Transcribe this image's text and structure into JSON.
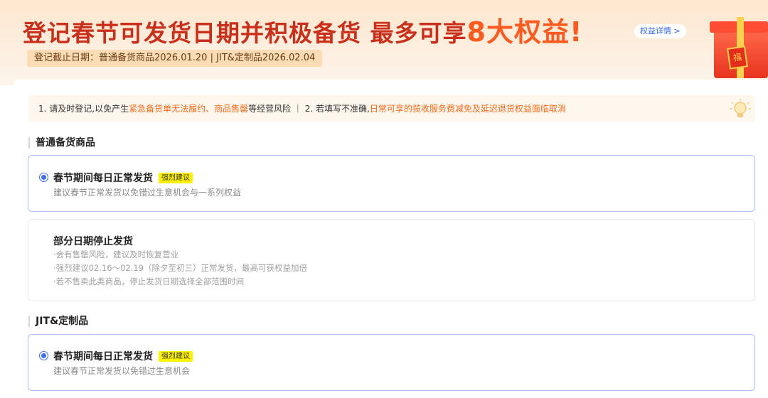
{
  "banner": {
    "title_main": "登记春节可发货日期并积极备货 最多可享",
    "title_accent": "8大权益!",
    "benefit_link": "权益详情 >",
    "deadline": "登记截止日期：普通备货商品2026.01.20 | JIT&定制品2026.02.04",
    "gift_tag": "福"
  },
  "notice": {
    "part1": "1. 请及时登记,以免产生",
    "part1_hl": "紧急备货单无法履约、商品售罄",
    "part2": "等经营风险 ｜ 2. 若填写不准确,",
    "part2_hl": "日常可享的揽收服务费减免及延迟退货权益面临取消"
  },
  "sections": {
    "regular": {
      "title": "普通备货商品",
      "option_normal": {
        "title": "春节期间每日正常发货",
        "badge": "强烈建议",
        "desc": "建议春节正常发货以免错过生意机会与一系列权益"
      },
      "option_partial": {
        "title": "部分日期停止发货",
        "bullets": [
          "·会有售罄风险，建议及时恢复营业",
          "·强烈建议02.16～02.19（除夕至初三）正常发货，最高可获权益加倍",
          "·若不售卖此类商品，停止发货日期选择全部范围时间"
        ]
      }
    },
    "jit": {
      "title": "JIT&定制品",
      "option_normal": {
        "title": "春节期间每日正常发货",
        "badge": "强烈建议",
        "desc": "建议春节正常发货以免错过生意机会"
      }
    }
  },
  "colors": {
    "banner_title": "#c9301c",
    "accent": "#ff5a1f",
    "highlight": "#f26a1a",
    "radio": "#3d6ff0",
    "badge_bg": "#fff200"
  }
}
